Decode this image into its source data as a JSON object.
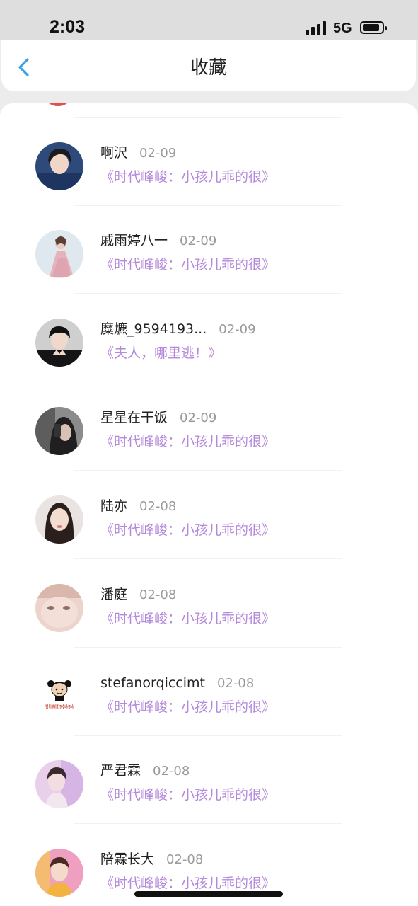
{
  "status_bar": {
    "time": "2:03",
    "network": "5G",
    "battery_level": 0.8
  },
  "header": {
    "title": "收藏",
    "back_icon": "chevron-left-icon"
  },
  "colors": {
    "accent_link": "#b489db",
    "back_icon": "#3aa0e8",
    "date": "#9a9a9a"
  },
  "favorites": [
    {
      "user": "啊沢",
      "date": "02-09",
      "title": "《时代峰峻：小孩儿乖的很》"
    },
    {
      "user": "戚雨婷八一",
      "date": "02-09",
      "title": "《时代峰峻：小孩儿乖的很》"
    },
    {
      "user": "糜爊_9594193...",
      "date": "02-09",
      "title": "《夫人，哪里逃！》"
    },
    {
      "user": "星星在干饭",
      "date": "02-09",
      "title": "《时代峰峻：小孩儿乖的很》"
    },
    {
      "user": "陆亦",
      "date": "02-08",
      "title": "《时代峰峻：小孩儿乖的很》"
    },
    {
      "user": "潘庭",
      "date": "02-08",
      "title": "《时代峰峻：小孩儿乖的很》"
    },
    {
      "user": "stefanorqiccimt",
      "date": "02-08",
      "title": "《时代峰峻：小孩儿乖的很》",
      "avatar_caption": "别闹你妈妈"
    },
    {
      "user": "严君霖",
      "date": "02-08",
      "title": "《时代峰峻：小孩儿乖的很》"
    },
    {
      "user": "陪霖长大",
      "date": "02-08",
      "title": "《时代峰峻：小孩儿乖的很》"
    }
  ]
}
